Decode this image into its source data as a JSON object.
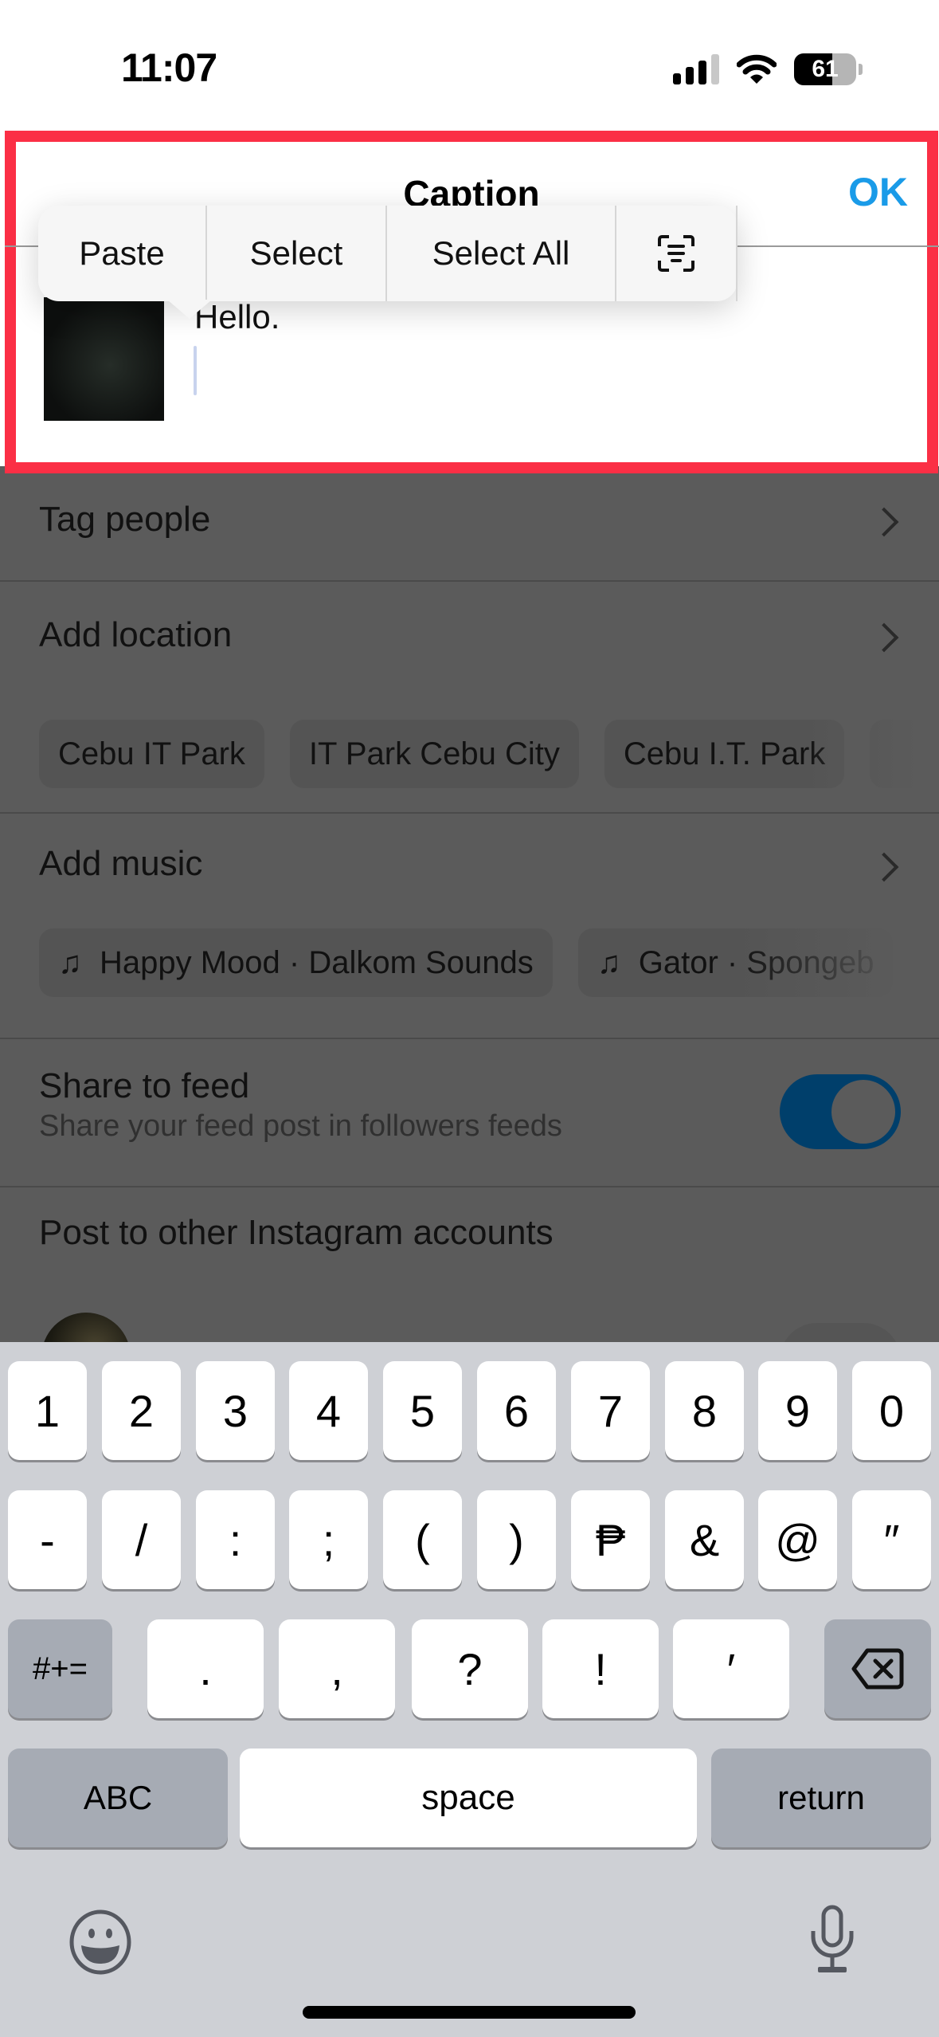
{
  "status_bar": {
    "time": "11:07",
    "battery_percent": 61,
    "battery_label": "61",
    "signal_bars_active": 3,
    "signal_bars_total": 4,
    "icons": [
      "cellular-signal-icon",
      "wifi-icon",
      "battery-icon"
    ]
  },
  "caption_editor": {
    "title": "Caption",
    "ok_label": "OK",
    "caption_text": "Hello.",
    "highlight_color": "#fb2f45",
    "ok_color": "#1a9be8"
  },
  "edit_menu": {
    "items": [
      {
        "label": "Paste"
      },
      {
        "label": "Select"
      },
      {
        "label": "Select All"
      },
      {
        "icon": "scan-text-icon"
      }
    ]
  },
  "post_options": {
    "tag_people": "Tag people",
    "add_location": "Add location",
    "location_suggestions": [
      "Cebu IT Park",
      "IT Park Cebu City",
      "Cebu I.T. Park"
    ],
    "add_music": "Add music",
    "music_suggestions": [
      {
        "icon": "music-note-icon",
        "label": "Happy Mood · Dalkom Sounds"
      },
      {
        "icon": "music-note-icon",
        "label": "Gator · Spongeb"
      }
    ],
    "share_to_feed": {
      "title": "Share to feed",
      "subtitle": "Share your feed post in followers feeds",
      "enabled": true,
      "toggle_color": "#003f6b"
    },
    "other_accounts_title": "Post to other Instagram accounts",
    "other_account_toggle_enabled": false
  },
  "keyboard": {
    "row1": [
      "1",
      "2",
      "3",
      "4",
      "5",
      "6",
      "7",
      "8",
      "9",
      "0"
    ],
    "row2": [
      "-",
      "/",
      ":",
      ";",
      "(",
      ")",
      "₱",
      "&",
      "@",
      "″"
    ],
    "row3_mode": "#+=",
    "row3": [
      ".",
      ",",
      "?",
      "!",
      "′"
    ],
    "row4_abc": "ABC",
    "row4_space": "space",
    "row4_return": "return",
    "icons": [
      "delete-icon",
      "emoji-icon",
      "microphone-icon"
    ]
  }
}
